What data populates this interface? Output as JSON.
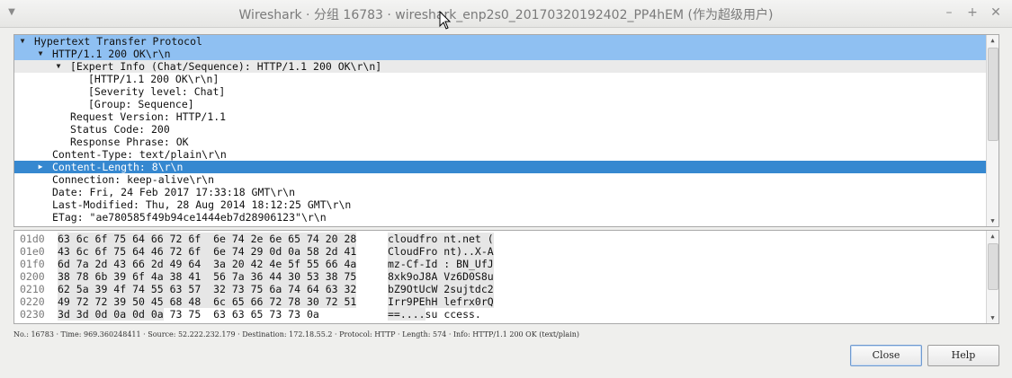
{
  "window": {
    "title": "Wireshark · 分组 16783 · wireshark_enp2s0_20170320192402_PP4hEM (作为超级用户)",
    "controls": {
      "minimize": "–",
      "maximize": "+",
      "close": "✕"
    }
  },
  "tree": {
    "rows": [
      {
        "label": "Hypertext Transfer Protocol",
        "indent": 0,
        "arrow": "down",
        "style": "sel-light"
      },
      {
        "label": "HTTP/1.1 200 OK\\r\\n",
        "indent": 1,
        "arrow": "down",
        "style": "sel-light"
      },
      {
        "label": "[Expert Info (Chat/Sequence): HTTP/1.1 200 OK\\r\\n]",
        "indent": 2,
        "arrow": "down",
        "style": "band"
      },
      {
        "label": "[HTTP/1.1 200 OK\\r\\n]",
        "indent": 3,
        "arrow": "",
        "style": ""
      },
      {
        "label": "[Severity level: Chat]",
        "indent": 3,
        "arrow": "",
        "style": ""
      },
      {
        "label": "[Group: Sequence]",
        "indent": 3,
        "arrow": "",
        "style": ""
      },
      {
        "label": "Request Version: HTTP/1.1",
        "indent": 2,
        "arrow": "",
        "style": ""
      },
      {
        "label": "Status Code: 200",
        "indent": 2,
        "arrow": "",
        "style": ""
      },
      {
        "label": "Response Phrase: OK",
        "indent": 2,
        "arrow": "",
        "style": ""
      },
      {
        "label": "Content-Type: text/plain\\r\\n",
        "indent": 1,
        "arrow": "",
        "style": ""
      },
      {
        "label": "Content-Length: 8\\r\\n",
        "indent": 1,
        "arrow": "right",
        "style": "sel-dark"
      },
      {
        "label": "Connection: keep-alive\\r\\n",
        "indent": 1,
        "arrow": "",
        "style": ""
      },
      {
        "label": "Date: Fri, 24 Feb 2017 17:33:18 GMT\\r\\n",
        "indent": 1,
        "arrow": "",
        "style": ""
      },
      {
        "label": "Last-Modified: Thu, 28 Aug 2014 18:12:25 GMT\\r\\n",
        "indent": 1,
        "arrow": "",
        "style": ""
      },
      {
        "label": "ETag: \"ae780585f49b94ce1444eb7d28906123\"\\r\\n",
        "indent": 1,
        "arrow": "",
        "style": ""
      }
    ]
  },
  "hex": {
    "rows": [
      {
        "offset": "01d0",
        "bytes": "63 6c 6f 75 64 66 72 6f  6e 74 2e 6e 65 74 20 28",
        "ascii": "cloudfro nt.net ("
      },
      {
        "offset": "01e0",
        "bytes": "43 6c 6f 75 64 46 72 6f  6e 74 29 0d 0a 58 2d 41",
        "ascii": "CloudFro nt)..X-A"
      },
      {
        "offset": "01f0",
        "bytes": "6d 7a 2d 43 66 2d 49 64  3a 20 42 4e 5f 55 66 4a",
        "ascii": "mz-Cf-Id : BN_UfJ"
      },
      {
        "offset": "0200",
        "bytes": "38 78 6b 39 6f 4a 38 41  56 7a 36 44 30 53 38 75",
        "ascii": "8xk9oJ8A Vz6D0S8u"
      },
      {
        "offset": "0210",
        "bytes": "62 5a 39 4f 74 55 63 57  32 73 75 6a 74 64 63 32",
        "ascii": "bZ9OtUcW 2sujtdc2"
      },
      {
        "offset": "0220",
        "bytes": "49 72 72 39 50 45 68 48  6c 65 66 72 78 30 72 51",
        "ascii": "Irr9PEhH lefrx0rQ"
      },
      {
        "offset": "0230",
        "bytes_hl": "3d 3d 0d 0a 0d 0a",
        "bytes_rest": " 73 75  63 63 65 73 73 0a",
        "ascii_hl": "==....",
        "ascii_rest": "su ccess."
      }
    ]
  },
  "status_line": "No.: 16783 · Time: 969.360248411 · Source: 52.222.232.179 · Destination: 172.18.55.2 · Protocol: HTTP · Length: 574 · Info: HTTP/1.1 200 OK (text/plain)",
  "buttons": {
    "close": "Close",
    "help": "Help"
  }
}
